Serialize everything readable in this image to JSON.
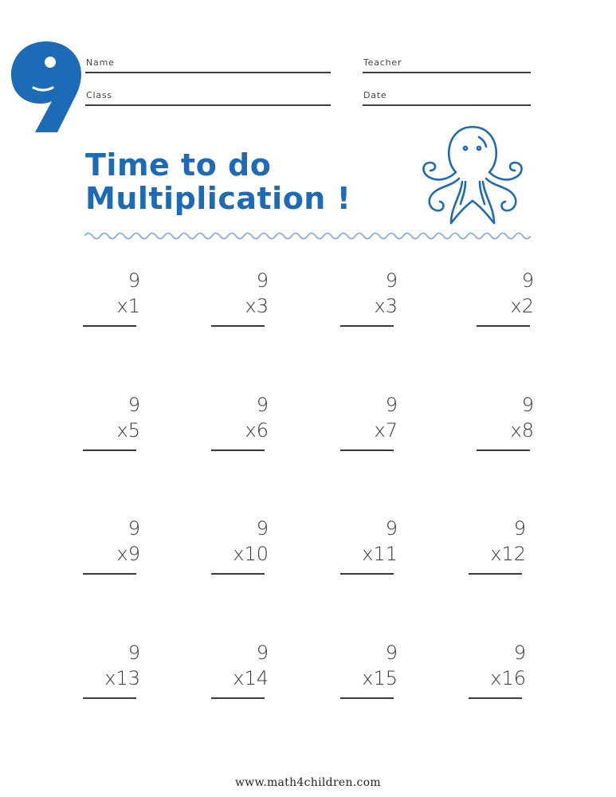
{
  "worksheet": {
    "table_number": "9",
    "accent_color": "#1d6ab7",
    "fields": {
      "name_label": "Name",
      "class_label": "Class",
      "teacher_label": "Teacher",
      "date_label": "Date"
    },
    "title_line1": "Time to do",
    "title_line2": "Multiplication !",
    "illustration": "octopus-icon",
    "problems": [
      {
        "top": "9",
        "mult": "x1"
      },
      {
        "top": "9",
        "mult": "x3"
      },
      {
        "top": "9",
        "mult": "x3"
      },
      {
        "top": "9",
        "mult": "x2"
      },
      {
        "top": "9",
        "mult": "x5"
      },
      {
        "top": "9",
        "mult": "x6"
      },
      {
        "top": "9",
        "mult": "x7"
      },
      {
        "top": "9",
        "mult": "x8"
      },
      {
        "top": "9",
        "mult": "x9"
      },
      {
        "top": "9",
        "mult": "x10"
      },
      {
        "top": "9",
        "mult": "x11"
      },
      {
        "top": "9",
        "mult": "x12"
      },
      {
        "top": "9",
        "mult": "x13"
      },
      {
        "top": "9",
        "mult": "x14"
      },
      {
        "top": "9",
        "mult": "x15"
      },
      {
        "top": "9",
        "mult": "x16"
      }
    ],
    "footer": "www.math4children.com"
  }
}
